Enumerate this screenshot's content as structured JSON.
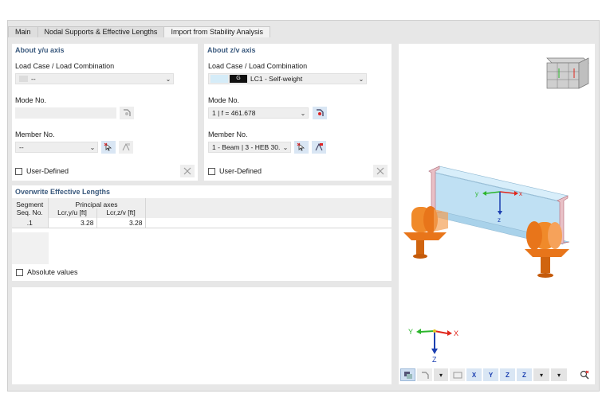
{
  "tabs": [
    {
      "label": "Main",
      "active": false
    },
    {
      "label": "Nodal Supports & Effective Lengths",
      "active": false
    },
    {
      "label": "Import from Stability Analysis",
      "active": true
    }
  ],
  "about_y": {
    "title": "About y/u axis",
    "load_case_label": "Load Case / Load Combination",
    "load_case_value": "--",
    "mode_label": "Mode No.",
    "mode_value": "",
    "member_label": "Member No.",
    "member_value": "--",
    "user_defined_label": "User-Defined",
    "user_defined_checked": false
  },
  "about_z": {
    "title": "About z/v axis",
    "load_case_label": "Load Case / Load Combination",
    "load_case_tag": "G",
    "load_case_value": "LC1 - Self-weight",
    "mode_label": "Mode No.",
    "mode_value": "1 | f = 461.678",
    "member_label": "Member No.",
    "member_value": "1 - Beam | 3 - HEB 30...",
    "user_defined_label": "User-Defined",
    "user_defined_checked": false
  },
  "overwrite": {
    "title": "Overwrite Effective Lengths",
    "col_segment_1": "Segment",
    "col_segment_2": "Seq. No.",
    "col_group": "Principal axes",
    "col_lcry": "Lcr,y/u [ft]",
    "col_lcrz": "Lcr,z/v [ft]",
    "rows": [
      {
        "seq": ".1",
        "lcry": "3.28",
        "lcrz": "3.28"
      }
    ],
    "absolute_values_label": "Absolute values",
    "absolute_values_checked": false
  },
  "preview": {
    "axis_labels": {
      "x": "x",
      "y": "y",
      "z": "z"
    },
    "triad_labels": {
      "x": "X",
      "y": "Y",
      "z": "Z"
    },
    "colors": {
      "beam": "#bfe0f3",
      "support": "#e8751a",
      "x_axis": "#e0261b",
      "y_axis": "#2bb52b",
      "z_axis": "#1b3fb0"
    }
  },
  "toolbar_icons": [
    "render-mode-icon",
    "show-values-icon",
    "dropdown-icon",
    "hide-icon",
    "view-x-icon",
    "view-y-icon",
    "view-z-icon",
    "view-iso-icon",
    "wireframe-dropdown-icon",
    "display-dropdown-icon",
    "reset-view-icon"
  ],
  "toolbar_labels": {
    "view_x": "X",
    "view_y": "Y",
    "view_z": "Z",
    "view_iso": "Z"
  }
}
